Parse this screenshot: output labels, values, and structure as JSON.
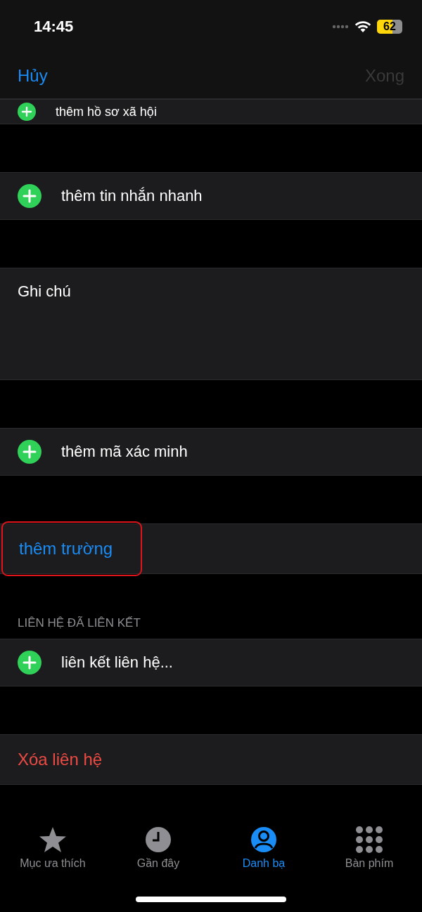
{
  "status_bar": {
    "time": "14:45",
    "battery": "62"
  },
  "nav": {
    "cancel": "Hủy",
    "done": "Xong",
    "done_disabled": true
  },
  "sections": [
    {
      "kind": "add",
      "label": "thêm hồ sơ xã hội",
      "cut_off": true
    },
    {
      "kind": "add",
      "label": "thêm tin nhắn nhanh"
    },
    {
      "kind": "notes",
      "label": "Ghi chú"
    },
    {
      "kind": "add",
      "label": "thêm mã xác minh"
    },
    {
      "kind": "link",
      "label": "thêm trường",
      "highlighted": true
    },
    {
      "kind": "add",
      "label": "liên kết liên hệ...",
      "header": "LIÊN HỆ ĐÃ LIÊN KẾT"
    },
    {
      "kind": "delete",
      "label": "Xóa liên hệ"
    }
  ],
  "tabs": [
    {
      "kind": "star",
      "label": "Mục ưa thích",
      "selected": false
    },
    {
      "kind": "clock",
      "label": "Gần đây",
      "selected": false
    },
    {
      "kind": "person",
      "label": "Danh bạ",
      "selected": true
    },
    {
      "kind": "keypad",
      "label": "Bàn phím",
      "selected": false
    }
  ]
}
